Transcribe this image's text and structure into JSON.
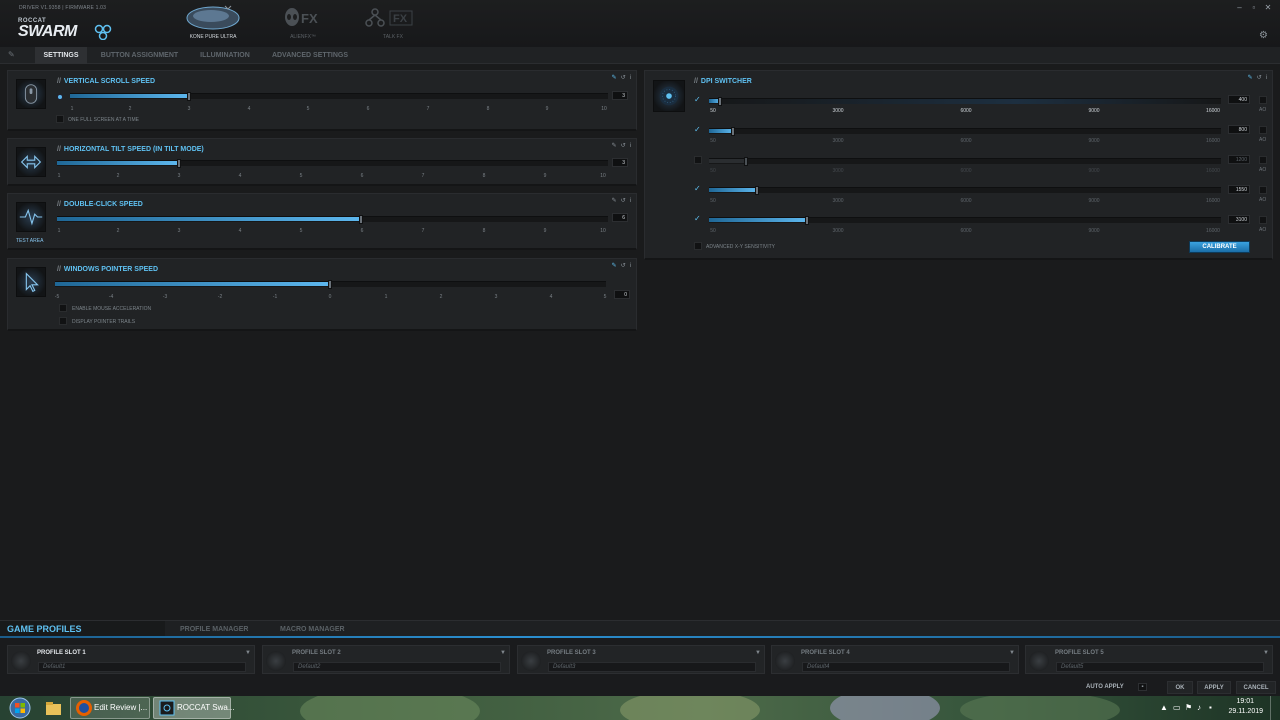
{
  "app": {
    "driver_info": "DRIVER V1.9358 | FIRMWARE 1.03",
    "logo_brand": "ROCCAT",
    "logo_name": "SWARM",
    "window_controls": [
      "–",
      "▫",
      "✕"
    ],
    "settings_icon": "gear-icon"
  },
  "header_tabs": [
    {
      "label": "KONE PURE ULTRA",
      "active": true
    },
    {
      "label": "ALIENFX™",
      "active": false
    },
    {
      "label": "TALK FX",
      "active": false
    }
  ],
  "sub_tabs": [
    "SETTINGS",
    "BUTTON ASSIGNMENT",
    "ILLUMINATION",
    "ADVANCED SETTINGS"
  ],
  "vertical_scroll": {
    "title": "VERTICAL SCROLL SPEED",
    "value": "3",
    "ticks": [
      "1",
      "2",
      "3",
      "4",
      "5",
      "6",
      "7",
      "8",
      "9",
      "10"
    ],
    "checkbox_label": "ONE FULL SCREEN AT A TIME"
  },
  "horizontal_tilt": {
    "title": "HORIZONTAL TILT SPEED (IN TILT MODE)",
    "value": "3",
    "ticks": [
      "1",
      "2",
      "3",
      "4",
      "5",
      "6",
      "7",
      "8",
      "9",
      "10"
    ]
  },
  "double_click": {
    "title": "DOUBLE-CLICK SPEED",
    "value": "6",
    "ticks": [
      "1",
      "2",
      "3",
      "4",
      "5",
      "6",
      "7",
      "8",
      "9",
      "10"
    ],
    "test_area_label": "TEST AREA"
  },
  "pointer_speed": {
    "title": "WINDOWS POINTER SPEED",
    "value": "0",
    "ticks": [
      "-5",
      "-4",
      "-3",
      "-2",
      "-1",
      "0",
      "1",
      "2",
      "3",
      "4",
      "5"
    ],
    "checkbox_accel": "ENABLE MOUSE ACCELERATION",
    "checkbox_trails": "DISPLAY POINTER TRAILS"
  },
  "dpi_switcher": {
    "title": "DPI SWITCHER",
    "scale": [
      "50",
      "3000",
      "6000",
      "9000",
      "16000"
    ],
    "levels": [
      {
        "value": "400",
        "enabled": true,
        "fraction": 0.022
      },
      {
        "value": "800",
        "enabled": true,
        "fraction": 0.047
      },
      {
        "value": "1200",
        "enabled": false,
        "fraction": 0.072
      },
      {
        "value": "1550",
        "enabled": true,
        "fraction": 0.094
      },
      {
        "value": "3100",
        "enabled": true,
        "fraction": 0.191
      }
    ],
    "ao_label": "AO",
    "advanced_xy_label": "ADVANCED X-Y SENSITIVITY",
    "calibrate_label": "CALIBRATE"
  },
  "game_profiles": {
    "title": "GAME PROFILES",
    "tabs": [
      "PROFILE MANAGER",
      "MACRO MANAGER"
    ],
    "slots": [
      {
        "name": "PROFILE SLOT 1",
        "profile": "Default1",
        "active": true
      },
      {
        "name": "PROFILE SLOT 2",
        "profile": "Default2",
        "active": false
      },
      {
        "name": "PROFILE SLOT 3",
        "profile": "Default3",
        "active": false
      },
      {
        "name": "PROFILE SLOT 4",
        "profile": "Default4",
        "active": false
      },
      {
        "name": "PROFILE SLOT 5",
        "profile": "Default5",
        "active": false
      }
    ]
  },
  "actions": {
    "auto_apply": "AUTO APPLY",
    "ok": "OK",
    "apply": "APPLY",
    "cancel": "CANCEL"
  },
  "taskbar": {
    "tasks": [
      {
        "label": "Edit Review |...",
        "icon": "firefox-icon"
      },
      {
        "label": "ROCCAT Swa...",
        "icon": "roccat-swarm-icon"
      }
    ],
    "clock_time": "19:01",
    "clock_date": "29.11.2019"
  },
  "colors": {
    "accent": "#5fc1f2",
    "fill_start": "#1f6796",
    "fill_end": "#5db7ee",
    "panel_bg": "#212325",
    "body_bg": "#1a1b1c"
  }
}
